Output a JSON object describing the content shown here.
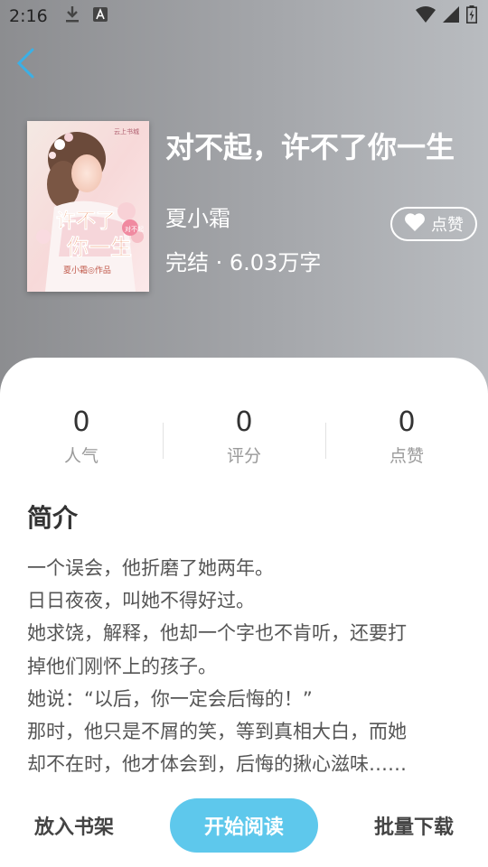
{
  "status_bar": {
    "time": "2:16",
    "icons": [
      "download-icon",
      "a-text-icon",
      "wifi-icon",
      "cellular-icon",
      "battery-icon"
    ]
  },
  "back": {
    "icon": "chevron-left-icon",
    "color": "#3bb0e6"
  },
  "book": {
    "title": "对不起，许不了你一生",
    "author": "夏小霜",
    "meta": "完结 · 6.03万字",
    "like_label": "点赞"
  },
  "stats": [
    {
      "value": "0",
      "label": "人气"
    },
    {
      "value": "0",
      "label": "评分"
    },
    {
      "value": "0",
      "label": "点赞"
    }
  ],
  "intro": {
    "title": "简介",
    "lines": [
      "一个误会，他折磨了她两年。",
      "日日夜夜，叫她不得好过。",
      "她求饶，解释，他却一个字也不肯听，还要打",
      "掉他们刚怀上的孩子。",
      "她说：“以后，你一定会后悔的！”",
      "那时，他只是不屑的笑，等到真相大白，而她",
      "却不在时，他才体会到，后悔的揪心滋味……"
    ]
  },
  "actions": {
    "add_shelf": "放入书架",
    "start_reading": "开始阅读",
    "batch_download": "批量下载"
  },
  "colors": {
    "accent": "#5ec8ec",
    "back_arrow": "#3bb0e6"
  }
}
